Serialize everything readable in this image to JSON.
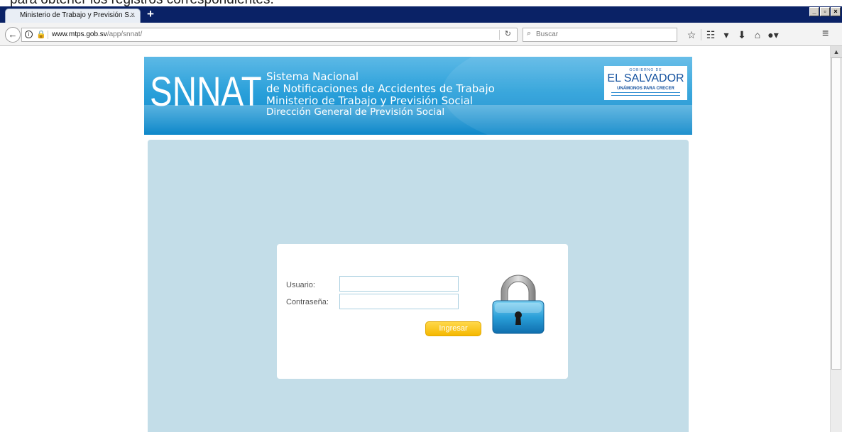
{
  "top_banner": {
    "text": "para obtener los registros correspondientes."
  },
  "browser": {
    "tab_title": "Ministerio de Trabajo y Previsión S...",
    "tab_close": "×",
    "new_tab": "+",
    "window_buttons": [
      "_",
      "▫",
      "×"
    ],
    "url_host": "www.mtps.gob.sv",
    "url_path": "/app/snnat/",
    "search_placeholder": "Buscar"
  },
  "icons": {
    "back": "back-arrow-icon",
    "info": "info-icon",
    "reload": "reload-icon",
    "search": "search-icon",
    "toolbar": [
      "bookmark-star-icon",
      "reading-list-icon",
      "pocket-icon",
      "download-icon",
      "home-icon",
      "addon-icon"
    ],
    "menu": "hamburger-menu-icon",
    "padlock": "padlock-icon"
  },
  "header": {
    "logo": "SNNAT",
    "lines": [
      "Sistema Nacional",
      "de Notificaciones de Accidentes de Trabajo",
      "Ministerio de Trabajo y Previsión Social",
      "Dirección General de Previsión Social"
    ],
    "gov_small": "GOBIERNO DE",
    "gov_big": "EL SALVADOR",
    "gov_tag": "UNÁMONOS PARA CRECER"
  },
  "login": {
    "usuario_label": "Usuario:",
    "password_label": "Contraseña:",
    "usuario_value": "",
    "password_value": "",
    "submit_label": "Ingresar"
  },
  "colors": {
    "tabbar": "#0a2266",
    "header_blue": "#2aa0da",
    "panel": "#c3dde8",
    "button": "#f5b800"
  }
}
